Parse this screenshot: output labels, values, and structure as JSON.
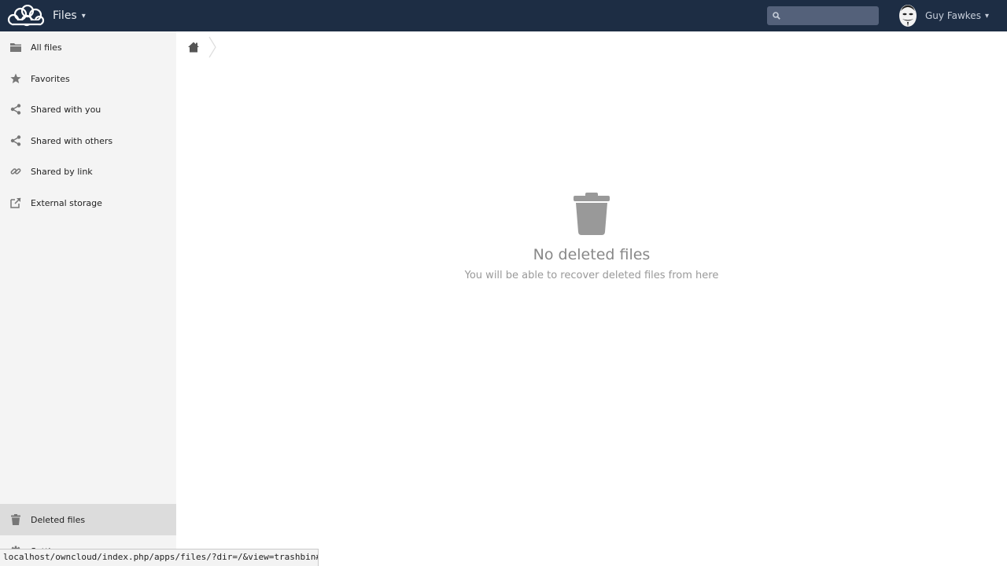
{
  "header": {
    "app_name": "Files",
    "caret": "▾",
    "search": {
      "placeholder": "",
      "value": ""
    },
    "user": {
      "name": "Guy Fawkes",
      "caret": "▾"
    },
    "background_color": "#1d2d44"
  },
  "sidebar": {
    "items": [
      {
        "label": "All files",
        "icon": "folder-icon"
      },
      {
        "label": "Favorites",
        "icon": "star-icon"
      },
      {
        "label": "Shared with you",
        "icon": "share-icon"
      },
      {
        "label": "Shared with others",
        "icon": "share-icon"
      },
      {
        "label": "Shared by link",
        "icon": "link-icon"
      },
      {
        "label": "External storage",
        "icon": "external-icon"
      }
    ],
    "bottom_items": [
      {
        "label": "Deleted files",
        "icon": "trash-icon",
        "active": true
      },
      {
        "label": "Settings",
        "icon": "gear-icon"
      }
    ]
  },
  "breadcrumb": {
    "home_icon": "home-icon"
  },
  "empty_state": {
    "icon": "trash-icon",
    "title": "No deleted files",
    "subtitle": "You will be able to recover deleted files from here"
  },
  "status_url": "localhost/owncloud/index.php/apps/files/?dir=/&view=trashbin#"
}
